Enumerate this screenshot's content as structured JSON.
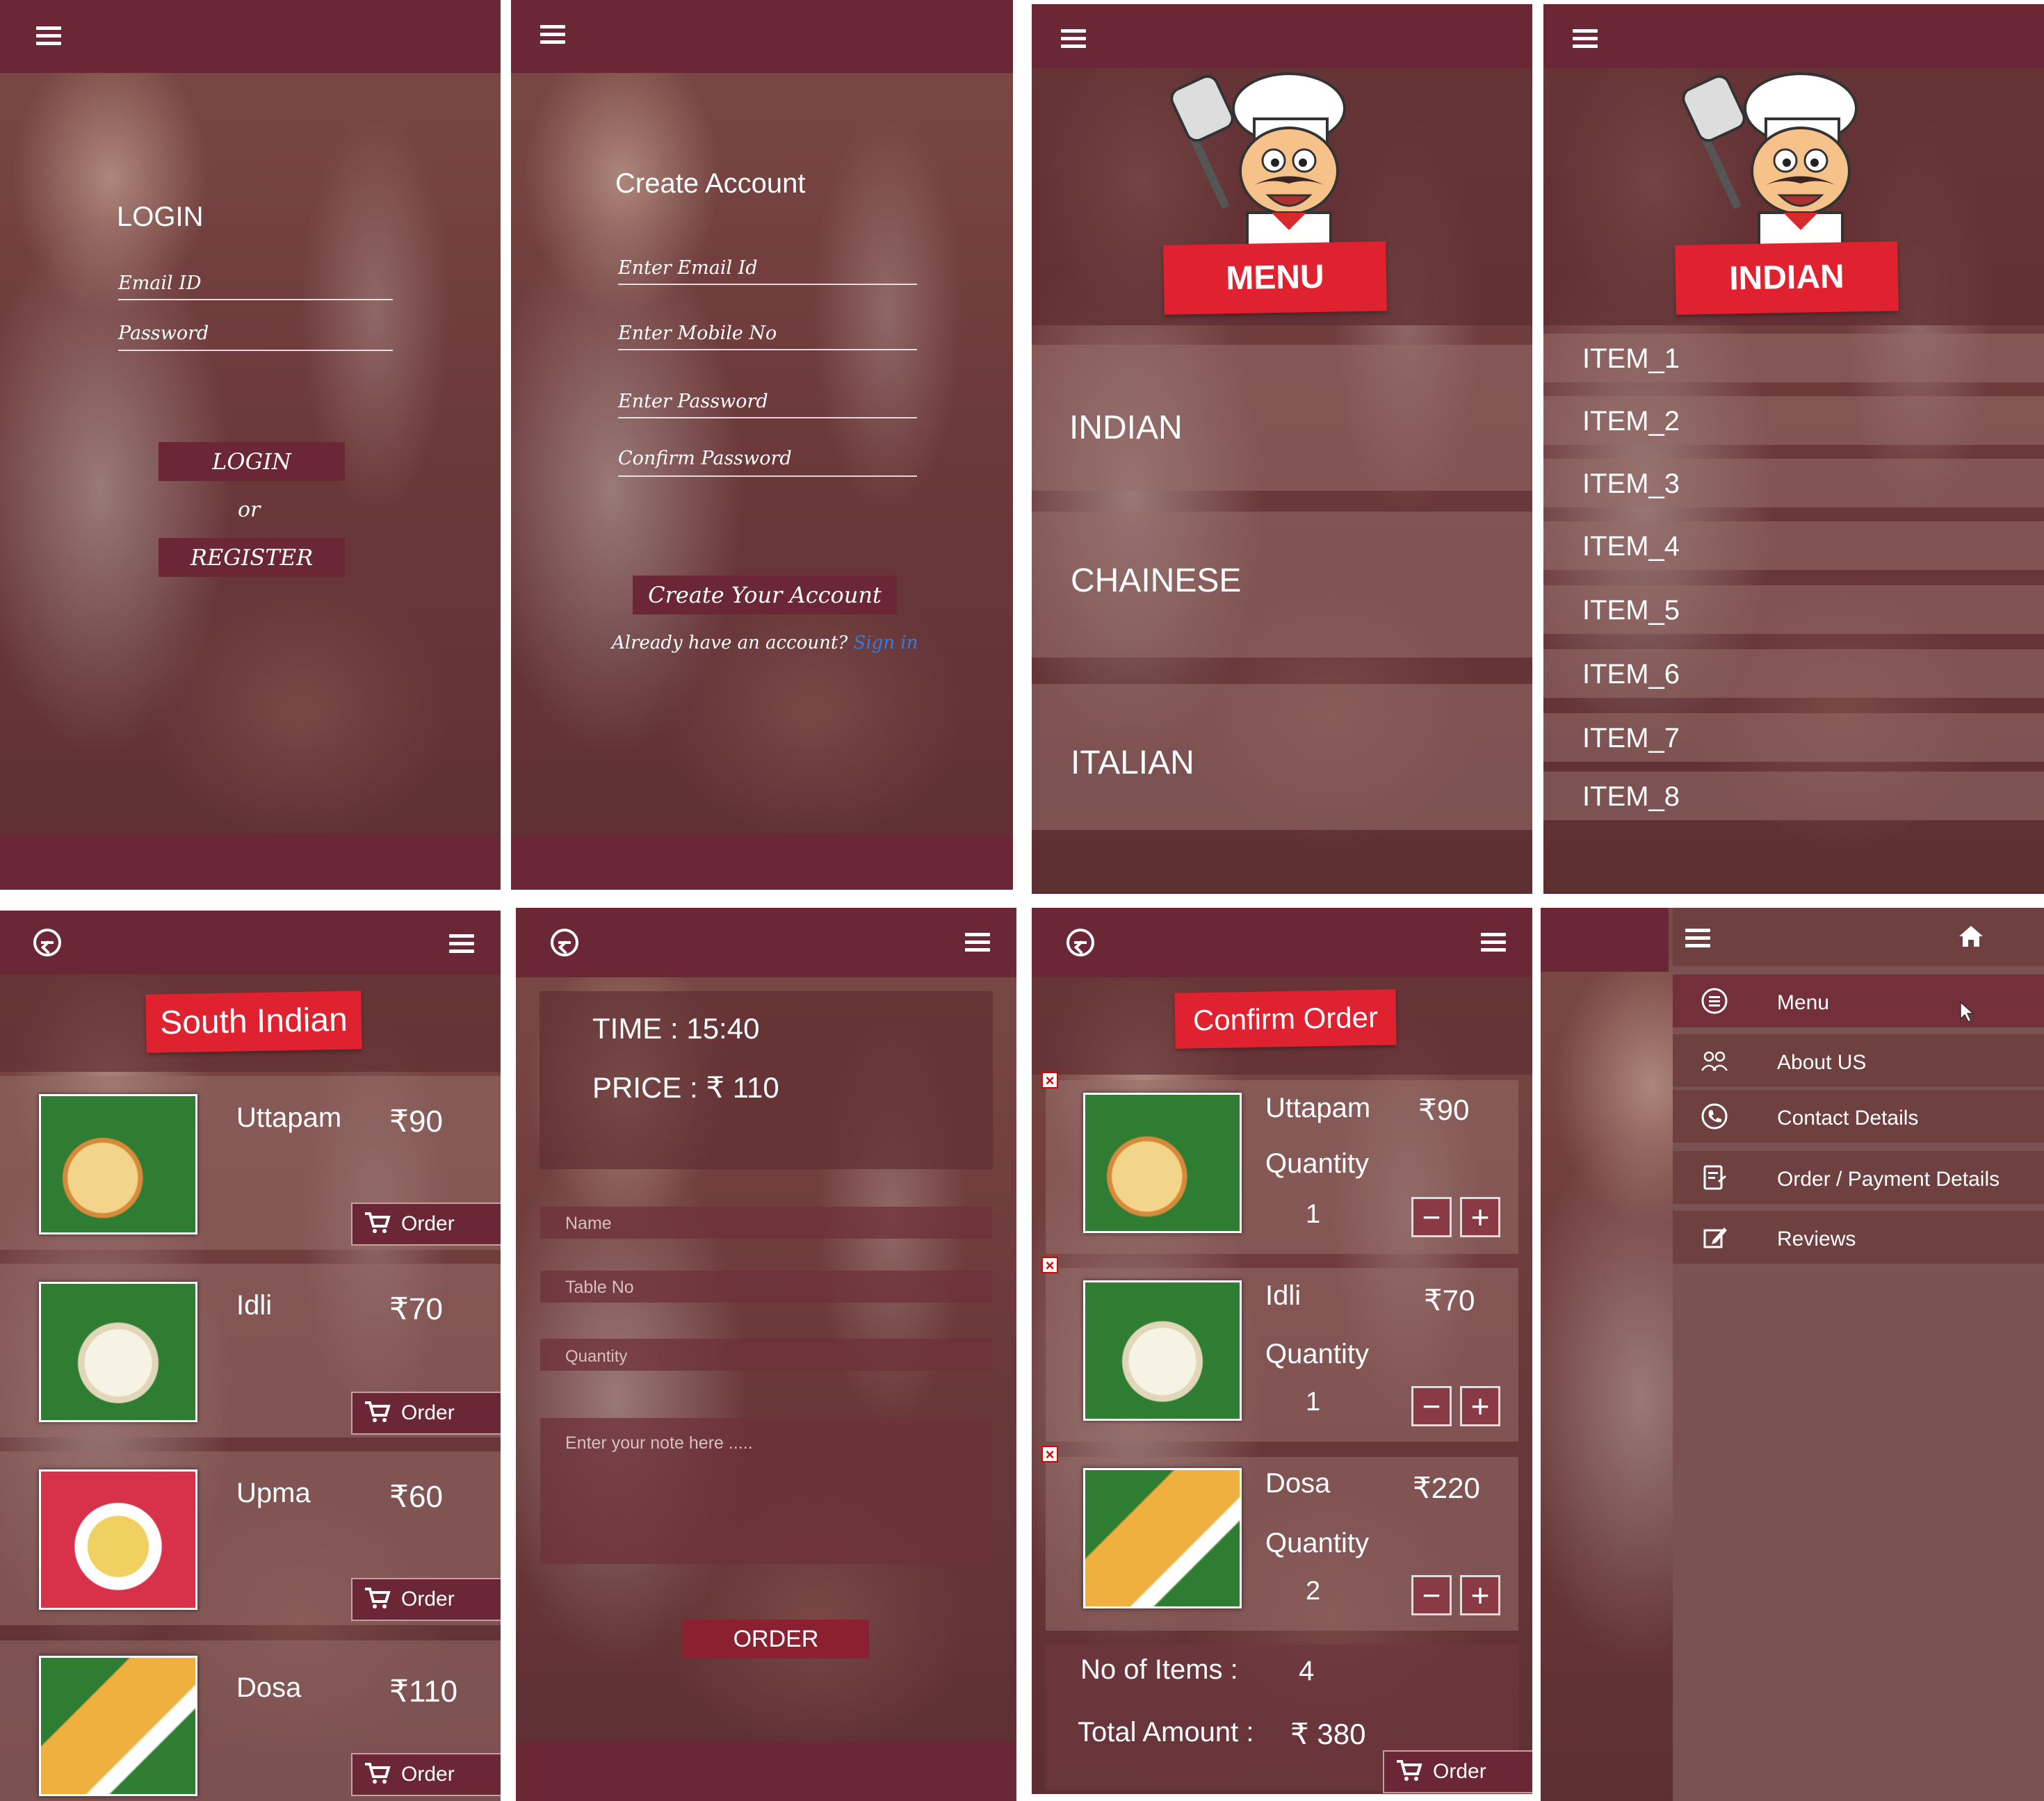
{
  "login": {
    "title": "LOGIN",
    "email_placeholder": "Email ID",
    "password_placeholder": "Password",
    "login_button": "LOGIN",
    "or_text": "or",
    "register_button": "REGISTER"
  },
  "create_account": {
    "title": "Create Account",
    "email_placeholder": "Enter Email Id",
    "mobile_placeholder": "Enter Mobile No",
    "password_placeholder": "Enter Password",
    "confirm_placeholder": "Confirm Password",
    "create_button": "Create Your Account",
    "already_text": "Already have an account?",
    "sign_in_link": "Sign in"
  },
  "menu_screen": {
    "banner": "MENU",
    "categories": [
      "INDIAN",
      "CHAINESE",
      "ITALIAN"
    ]
  },
  "indian_screen": {
    "banner": "INDIAN",
    "items": [
      "ITEM_1",
      "ITEM_2",
      "ITEM_3",
      "ITEM_4",
      "ITEM_5",
      "ITEM_6",
      "ITEM_7",
      "ITEM_8"
    ]
  },
  "south_indian": {
    "banner": "South Indian",
    "order_label": "Order",
    "items": [
      {
        "name": "Uttapam",
        "price": "₹90"
      },
      {
        "name": "Idli",
        "price": "₹70"
      },
      {
        "name": "Upma",
        "price": "₹60"
      },
      {
        "name": "Dosa",
        "price": "₹110"
      }
    ]
  },
  "order_form": {
    "time": "TIME : 15:40",
    "price": "PRICE :  ₹ 110",
    "name_placeholder": "Name",
    "table_placeholder": "Table No",
    "quantity_placeholder": "Quantity",
    "note_placeholder": "Enter your note here .....",
    "order_button": "ORDER"
  },
  "confirm_order": {
    "banner": "Confirm Order",
    "quantity_label": "Quantity",
    "items": [
      {
        "name": "Uttapam",
        "price": "₹90",
        "qty": "1"
      },
      {
        "name": "Idli",
        "price": "₹70",
        "qty": "1"
      },
      {
        "name": "Dosa",
        "price": "₹220",
        "qty": "2"
      }
    ],
    "items_label": "No of Items :",
    "items_count": "4",
    "total_label": "Total Amount :",
    "total_value": "₹ 380",
    "order_button": "Order"
  },
  "nav_drawer": {
    "items": [
      "Menu",
      "About US",
      "Contact Details",
      "Order / Payment  Details",
      "Reviews"
    ]
  },
  "colors": {
    "bar": "#6b2736",
    "ribbon": "#e02130",
    "link": "#3a7bd5"
  }
}
